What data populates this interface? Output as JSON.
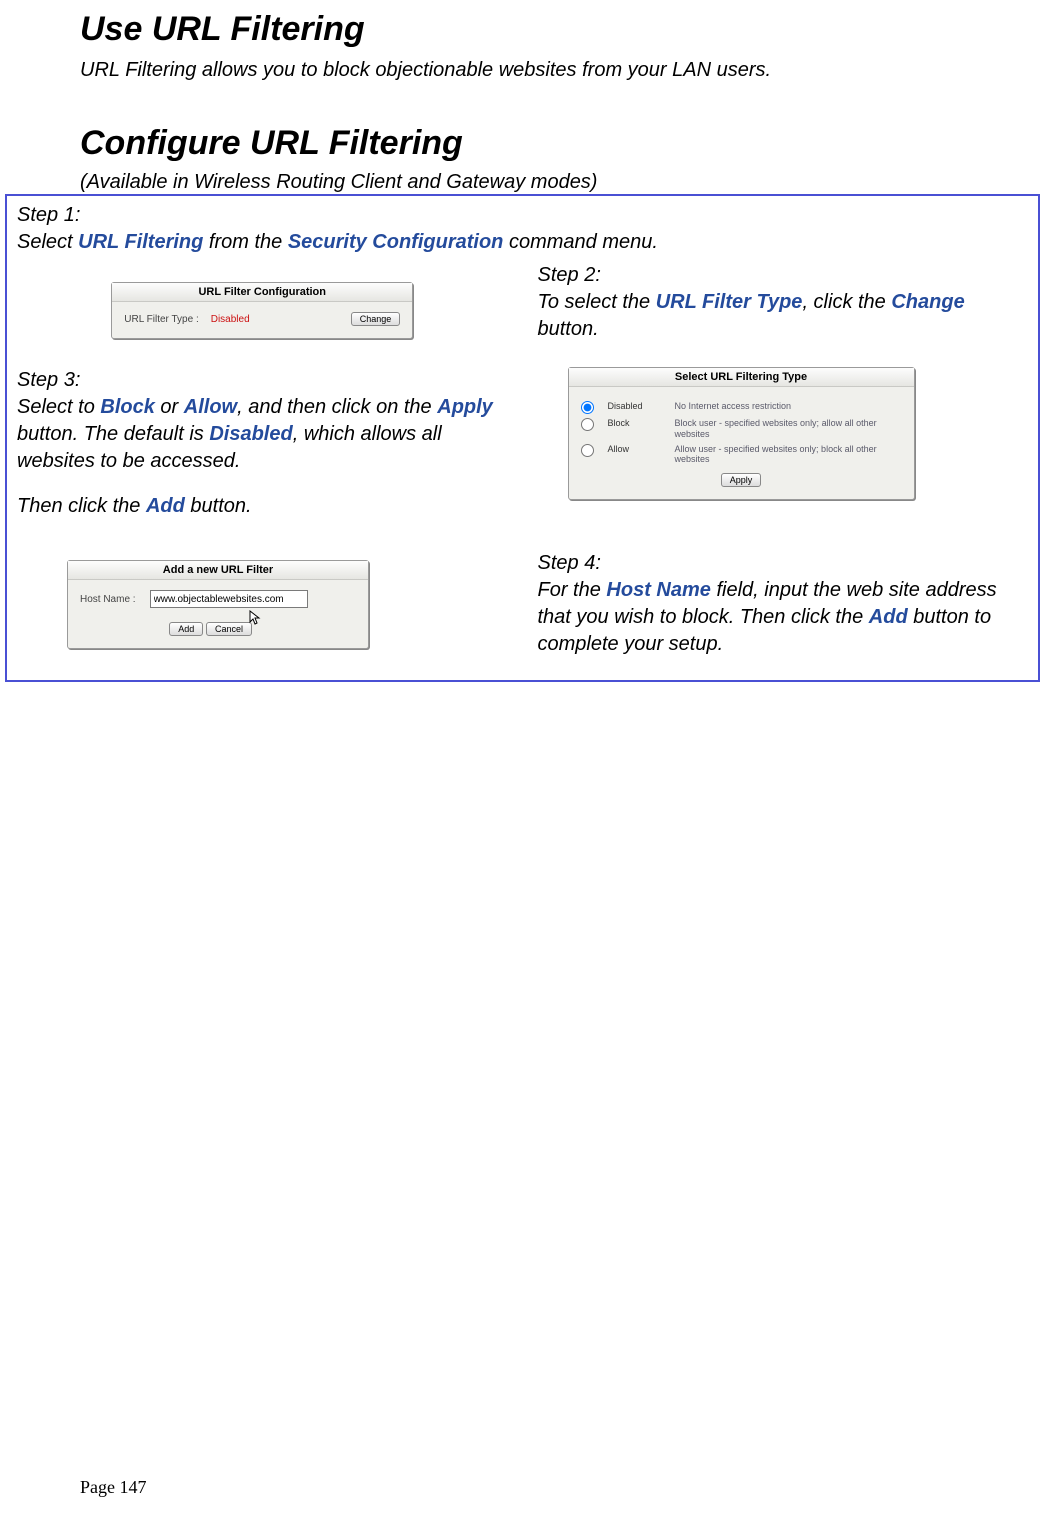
{
  "heading1": "Use URL Filtering",
  "lead": "URL Filtering allows you to block objectionable websites from your LAN users.",
  "heading2": "Configure URL Filtering",
  "availability": "(Available in Wireless Routing Client and Gateway modes)",
  "step1": {
    "label": "Step 1:",
    "pre": "Select ",
    "kw1": "URL Filtering",
    "mid": " from the ",
    "kw2": "Security Configuration",
    "post": " command menu."
  },
  "panel1": {
    "title": "URL Filter Configuration",
    "label": "URL Filter Type :",
    "value": "Disabled",
    "button": "Change"
  },
  "step2": {
    "label": "Step 2:",
    "pre": "To select the ",
    "kw1": "URL Filter Type",
    "mid": ", click the ",
    "kw2": "Change",
    "post": " button."
  },
  "step3": {
    "label": "Step 3:",
    "pre": "Select to ",
    "kw1": "Block",
    "mid1": " or ",
    "kw2": "Allow",
    "mid2": ", and then click on the ",
    "kw3": "Apply",
    "mid3": " button. The default is ",
    "kw4": "Disabled",
    "post": ", which allows all websites to be accessed.",
    "line2a": "Then click the ",
    "kw5": "Add",
    "line2b": " button."
  },
  "panel2": {
    "title": "Select URL Filtering Type",
    "opts": [
      {
        "label": "Disabled",
        "desc": "No Internet access restriction"
      },
      {
        "label": "Block",
        "desc": "Block user - specified websites only; allow all other websites"
      },
      {
        "label": "Allow",
        "desc": "Allow user - specified websites only; block all other websites"
      }
    ],
    "button": "Apply"
  },
  "panel3": {
    "title": "Add a new URL Filter",
    "label": "Host Name :",
    "value": "www.objectablewebsites.com",
    "add": "Add",
    "cancel": "Cancel"
  },
  "step4": {
    "label": "Step 4:",
    "pre": "For the ",
    "kw1": "Host Name",
    "mid1": " field, input the web site address that you wish to block. Then click the ",
    "kw2": "Add",
    "post": " button to complete your setup."
  },
  "page_number": "Page 147"
}
